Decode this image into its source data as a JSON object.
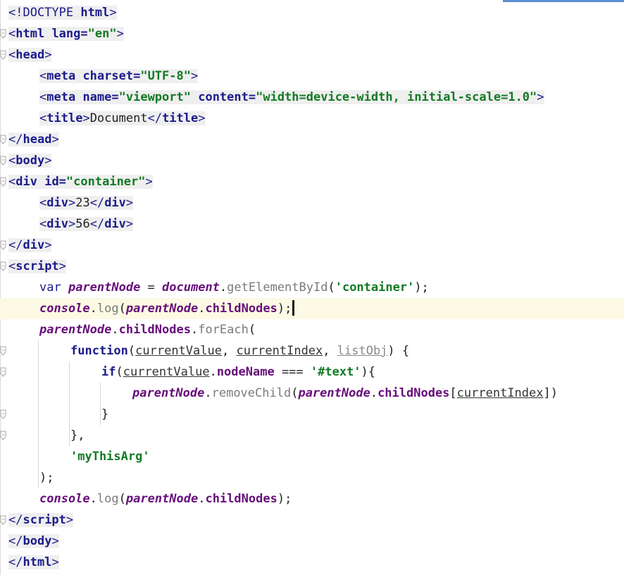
{
  "lines": [
    {
      "indent": 0,
      "tokens": [
        [
          "t",
          "<!DOCTYPE "
        ],
        [
          "tag",
          "html"
        ],
        [
          "t",
          ">"
        ]
      ]
    },
    {
      "indent": 0,
      "tokens": [
        [
          "t",
          "<"
        ],
        [
          "tag",
          "html "
        ],
        [
          "attr",
          "lang="
        ],
        [
          "str",
          "\"en\""
        ],
        [
          "t",
          ">"
        ]
      ]
    },
    {
      "indent": 0,
      "tokens": [
        [
          "t",
          "<"
        ],
        [
          "tag",
          "head"
        ],
        [
          "t",
          ">"
        ]
      ]
    },
    {
      "indent": 1,
      "tokens": [
        [
          "t",
          "<"
        ],
        [
          "tag",
          "meta "
        ],
        [
          "attr",
          "charset="
        ],
        [
          "str",
          "\"UTF-8\""
        ],
        [
          "t",
          ">"
        ]
      ]
    },
    {
      "indent": 1,
      "tokens": [
        [
          "t",
          "<"
        ],
        [
          "tag",
          "meta "
        ],
        [
          "attr",
          "name="
        ],
        [
          "str",
          "\"viewport\" "
        ],
        [
          "attr",
          "content="
        ],
        [
          "str",
          "\"width=device-width, initial-scale=1.0\""
        ],
        [
          "t",
          ">"
        ]
      ]
    },
    {
      "indent": 1,
      "tokens": [
        [
          "t",
          "<"
        ],
        [
          "tag",
          "title"
        ],
        [
          "t",
          ">"
        ],
        [
          "text",
          "Document"
        ],
        [
          "t",
          "</"
        ],
        [
          "tag",
          "title"
        ],
        [
          "t",
          ">"
        ]
      ]
    },
    {
      "indent": 0,
      "tokens": [
        [
          "t",
          "</"
        ],
        [
          "tag",
          "head"
        ],
        [
          "t",
          ">"
        ]
      ]
    },
    {
      "indent": 0,
      "tokens": [
        [
          "t",
          "<"
        ],
        [
          "tag",
          "body"
        ],
        [
          "t",
          ">"
        ]
      ]
    },
    {
      "indent": 0,
      "tokens": [
        [
          "t",
          "<"
        ],
        [
          "tag",
          "div "
        ],
        [
          "attr",
          "id="
        ],
        [
          "str",
          "\"container\""
        ],
        [
          "t",
          ">"
        ]
      ]
    },
    {
      "indent": 1,
      "tokens": [
        [
          "t",
          "<"
        ],
        [
          "tag",
          "div"
        ],
        [
          "t",
          ">"
        ],
        [
          "text",
          "23"
        ],
        [
          "t",
          "</"
        ],
        [
          "tag",
          "div"
        ],
        [
          "t",
          ">"
        ]
      ]
    },
    {
      "indent": 1,
      "tokens": [
        [
          "t",
          "<"
        ],
        [
          "tag",
          "div"
        ],
        [
          "t",
          ">"
        ],
        [
          "text",
          "56"
        ],
        [
          "t",
          "</"
        ],
        [
          "tag",
          "div"
        ],
        [
          "t",
          ">"
        ]
      ]
    },
    {
      "indent": 0,
      "tokens": [
        [
          "t",
          "</"
        ],
        [
          "tag",
          "div"
        ],
        [
          "t",
          ">"
        ]
      ]
    },
    {
      "indent": 0,
      "tokens": [
        [
          "t",
          "<"
        ],
        [
          "tag",
          "script"
        ],
        [
          "t",
          ">"
        ]
      ]
    },
    {
      "indent": 1,
      "tokens": [
        [
          "kw",
          "var "
        ],
        [
          "var",
          "parentNode"
        ],
        [
          "punc",
          " = "
        ],
        [
          "var",
          "document"
        ],
        [
          "punc",
          "."
        ],
        [
          "meth",
          "getElementById"
        ],
        [
          "punc",
          "("
        ],
        [
          "str",
          "'container'"
        ],
        [
          "punc",
          ");"
        ]
      ]
    },
    {
      "indent": 1,
      "current": true,
      "tokens": [
        [
          "var",
          "console"
        ],
        [
          "punc",
          "."
        ],
        [
          "meth",
          "log"
        ],
        [
          "punc",
          "("
        ],
        [
          "var",
          "parentNode"
        ],
        [
          "punc",
          "."
        ],
        [
          "prop",
          "childNodes"
        ],
        [
          "punc",
          ");"
        ]
      ]
    },
    {
      "indent": 1,
      "tokens": [
        [
          "var",
          "parentNode"
        ],
        [
          "punc",
          "."
        ],
        [
          "prop",
          "childNodes"
        ],
        [
          "punc",
          "."
        ],
        [
          "meth",
          "forEach"
        ],
        [
          "punc",
          "("
        ]
      ]
    },
    {
      "indent": 2,
      "tokens": [
        [
          "kwb",
          "function"
        ],
        [
          "punc",
          "("
        ],
        [
          "param",
          "currentValue"
        ],
        [
          "punc",
          ", "
        ],
        [
          "param",
          "currentIndex"
        ],
        [
          "punc",
          ", "
        ],
        [
          "param-unused",
          "listObj"
        ],
        [
          "punc",
          ") {"
        ]
      ]
    },
    {
      "indent": 3,
      "tokens": [
        [
          "kwb",
          "if"
        ],
        [
          "punc",
          "("
        ],
        [
          "param",
          "currentValue"
        ],
        [
          "punc",
          "."
        ],
        [
          "prop",
          "nodeName"
        ],
        [
          "punc",
          " === "
        ],
        [
          "str",
          "'#text'"
        ],
        [
          "punc",
          "){"
        ]
      ]
    },
    {
      "indent": 4,
      "tokens": [
        [
          "var",
          "parentNode"
        ],
        [
          "punc",
          "."
        ],
        [
          "meth",
          "removeChild"
        ],
        [
          "punc",
          "("
        ],
        [
          "var",
          "parentNode"
        ],
        [
          "punc",
          "."
        ],
        [
          "prop",
          "childNodes"
        ],
        [
          "punc",
          "["
        ],
        [
          "param",
          "currentIndex"
        ],
        [
          "punc",
          "])"
        ]
      ]
    },
    {
      "indent": 3,
      "tokens": [
        [
          "punc",
          "}"
        ]
      ]
    },
    {
      "indent": 2,
      "tokens": [
        [
          "punc",
          "},"
        ]
      ]
    },
    {
      "indent": 2,
      "tokens": [
        [
          "str",
          "'myThisArg'"
        ]
      ]
    },
    {
      "indent": 1,
      "tokens": [
        [
          "punc",
          ");"
        ]
      ]
    },
    {
      "indent": 1,
      "tokens": [
        [
          "var",
          "console"
        ],
        [
          "punc",
          "."
        ],
        [
          "meth",
          "log"
        ],
        [
          "punc",
          "("
        ],
        [
          "var",
          "parentNode"
        ],
        [
          "punc",
          "."
        ],
        [
          "prop",
          "childNodes"
        ],
        [
          "punc",
          ");"
        ]
      ]
    },
    {
      "indent": 0,
      "tokens": [
        [
          "t",
          "</"
        ],
        [
          "tag",
          "script"
        ],
        [
          "t",
          ">"
        ]
      ]
    },
    {
      "indent": 0,
      "tokens": [
        [
          "t",
          "</"
        ],
        [
          "tag",
          "body"
        ],
        [
          "t",
          ">"
        ]
      ]
    },
    {
      "indent": 0,
      "tokens": [
        [
          "t",
          "</"
        ],
        [
          "tag",
          "html"
        ],
        [
          "t",
          ">"
        ]
      ]
    }
  ],
  "fold_markers": [
    1,
    2,
    6,
    7,
    8,
    11,
    12,
    16,
    17,
    19,
    20,
    24
  ],
  "colors": {
    "tag": "#1b1b8c",
    "string": "#137a24",
    "variable": "#660e7a",
    "method": "#7a7a7a",
    "current_line": "#fcfae4",
    "tag_background": "#efefef"
  }
}
